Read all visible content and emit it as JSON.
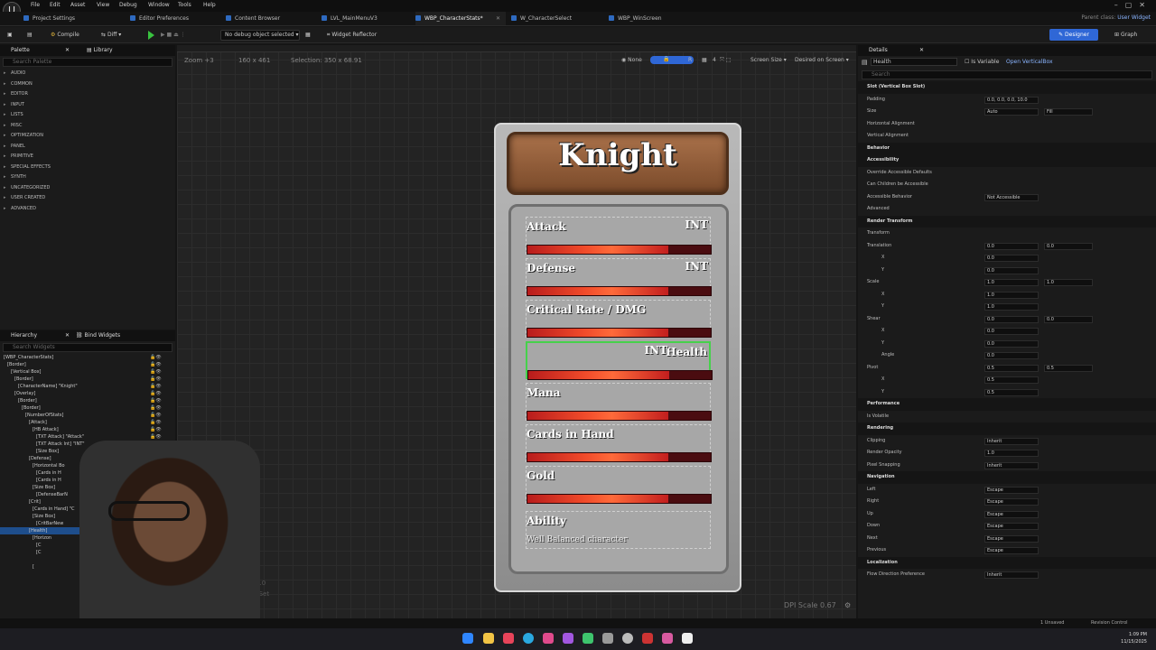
{
  "menu": [
    "File",
    "Edit",
    "Asset",
    "View",
    "Debug",
    "Window",
    "Tools",
    "Help"
  ],
  "tabs": [
    {
      "label": "Project Settings"
    },
    {
      "label": "Editor Preferences"
    },
    {
      "label": "Content Browser"
    },
    {
      "label": "LVL_MainMenuV3"
    },
    {
      "label": "WBP_CharacterStats*"
    },
    {
      "label": "W_CharacterSelect"
    },
    {
      "label": "WBP_WinScreen"
    }
  ],
  "parent_class": {
    "label": "Parent class:",
    "value": "User Widget"
  },
  "toolbar": {
    "compile": "Compile",
    "diff": "Diff",
    "debug_select": "No debug object selected",
    "widget_reflector": "Widget Reflector",
    "designer": "Designer",
    "graph": "Graph"
  },
  "palette": {
    "title": "Palette",
    "library": "Library",
    "search_placeholder": "Search Palette",
    "categories": [
      "AUDIO",
      "COMMON",
      "EDITOR",
      "INPUT",
      "LISTS",
      "MISC",
      "OPTIMIZATION",
      "PANEL",
      "PRIMITIVE",
      "SPECIAL EFFECTS",
      "SYNTH",
      "UNCATEGORIZED",
      "USER CREATED",
      "ADVANCED"
    ]
  },
  "hierarchy": {
    "title": "Hierarchy",
    "bind_widgets": "Bind Widgets",
    "search_placeholder": "Search Widgets",
    "rows": [
      "[WBP_CharacterStats]",
      "[Border]",
      "[Vertical Box]",
      "[Border]",
      "[CharacterName] \"Knight\"",
      "[Overlay]",
      "[Border]",
      "[Border]",
      "[NumberOfStats]",
      "[Attack]",
      "[HB Attack]",
      "[TXT Attack] \"Attack\"",
      "[TXT Attack Int] \"INT\"",
      "[Size Box]",
      "[Defense]",
      "[Horizontal Bo",
      "[Cards in H",
      "[Cards in H",
      "[Size Box]",
      "[DefenseBarN",
      "[Crit]",
      "[Cards in Hand] \"C",
      "[Size Box]",
      "[CritBarNew",
      "[Health]",
      "[Horizon",
      "[C",
      "[C",
      "",
      "[",
      ""
    ]
  },
  "viewport": {
    "zoom": "Zoom +3",
    "size": "160 x 461",
    "selection": "Selection: 350 x 68.91",
    "none": "None",
    "r": "R",
    "grid": "4",
    "screen_size": "Screen Size",
    "desired": "Desired on Screen",
    "dpi": "DPI Scale 0.67",
    "dpi_left": "Scale 1.0",
    "safe_zone": "e Zone Set"
  },
  "card": {
    "title": "Knight",
    "stats": [
      {
        "name": "Attack",
        "int": "INT",
        "fill": 0.77
      },
      {
        "name": "Defense",
        "int": "INT",
        "fill": 0.77
      },
      {
        "name": "Critical Rate / DMG",
        "int": "",
        "fill": 0.77
      },
      {
        "name": "Health",
        "int": "INT",
        "fill": 0.77
      },
      {
        "name": "Mana",
        "int": "",
        "fill": 0.77
      },
      {
        "name": "Cards in Hand",
        "int": "",
        "fill": 0.77
      },
      {
        "name": "Gold",
        "int": "",
        "fill": 0.77
      }
    ],
    "ability_label": "Ability",
    "ability_desc": "Well Balanced character"
  },
  "details": {
    "title": "Details",
    "name_value": "Health",
    "is_variable": "Is Variable",
    "open_vb": "Open VerticalBox",
    "search_placeholder": "Search",
    "rows": [
      {
        "label": "Slot (Vertical Box Slot)",
        "section": true
      },
      {
        "label": "Padding",
        "v1": "0.0, 0.0, 0.0, 10.0"
      },
      {
        "label": "Size",
        "v1": "Auto",
        "v2": "Fill"
      },
      {
        "label": "Horizontal Alignment"
      },
      {
        "label": "Vertical Alignment"
      },
      {
        "label": "Behavior",
        "section": true
      },
      {
        "label": "Accessibility",
        "section": true
      },
      {
        "label": "Override Accessible Defaults"
      },
      {
        "label": "Can Children be Accessible"
      },
      {
        "label": "Accessible Behavior",
        "v1": "Not Accessible"
      },
      {
        "label": "Advanced"
      },
      {
        "label": "Render Transform",
        "section": true
      },
      {
        "label": "Transform"
      },
      {
        "label": "Translation",
        "v1": "0.0",
        "v2": "0.0"
      },
      {
        "label": "X",
        "v1": "0.0"
      },
      {
        "label": "Y",
        "v1": "0.0"
      },
      {
        "label": "Scale",
        "v1": "1.0",
        "v2": "1.0"
      },
      {
        "label": "X",
        "v1": "1.0"
      },
      {
        "label": "Y",
        "v1": "1.0"
      },
      {
        "label": "Shear",
        "v1": "0.0",
        "v2": "0.0"
      },
      {
        "label": "X",
        "v1": "0.0"
      },
      {
        "label": "Y",
        "v1": "0.0"
      },
      {
        "label": "Angle",
        "v1": "0.0"
      },
      {
        "label": "Pivot",
        "v1": "0.5",
        "v2": "0.5"
      },
      {
        "label": "X",
        "v1": "0.5"
      },
      {
        "label": "Y",
        "v1": "0.5"
      },
      {
        "label": "Performance",
        "section": true
      },
      {
        "label": "Is Volatile"
      },
      {
        "label": "Rendering",
        "section": true
      },
      {
        "label": "Clipping",
        "v1": "Inherit"
      },
      {
        "label": "Render Opacity",
        "v1": "1.0"
      },
      {
        "label": "Pixel Snapping",
        "v1": "Inherit"
      },
      {
        "label": "Navigation",
        "section": true
      },
      {
        "label": "Left",
        "v1": "Escape"
      },
      {
        "label": "Right",
        "v1": "Escape"
      },
      {
        "label": "Up",
        "v1": "Escape"
      },
      {
        "label": "Down",
        "v1": "Escape"
      },
      {
        "label": "Next",
        "v1": "Escape"
      },
      {
        "label": "Previous",
        "v1": "Escape"
      },
      {
        "label": "Localization",
        "section": true
      },
      {
        "label": "Flow Direction Preference",
        "v1": "Inherit"
      }
    ]
  },
  "status": {
    "unsaved": "1 Unsaved",
    "revision": "Revision Control"
  },
  "clock": {
    "time": "1:09 PM",
    "date": "11/15/2025"
  },
  "colors": {
    "accent": "#2f67d6",
    "selection": "#46d14b",
    "bar": "#e8402a"
  }
}
